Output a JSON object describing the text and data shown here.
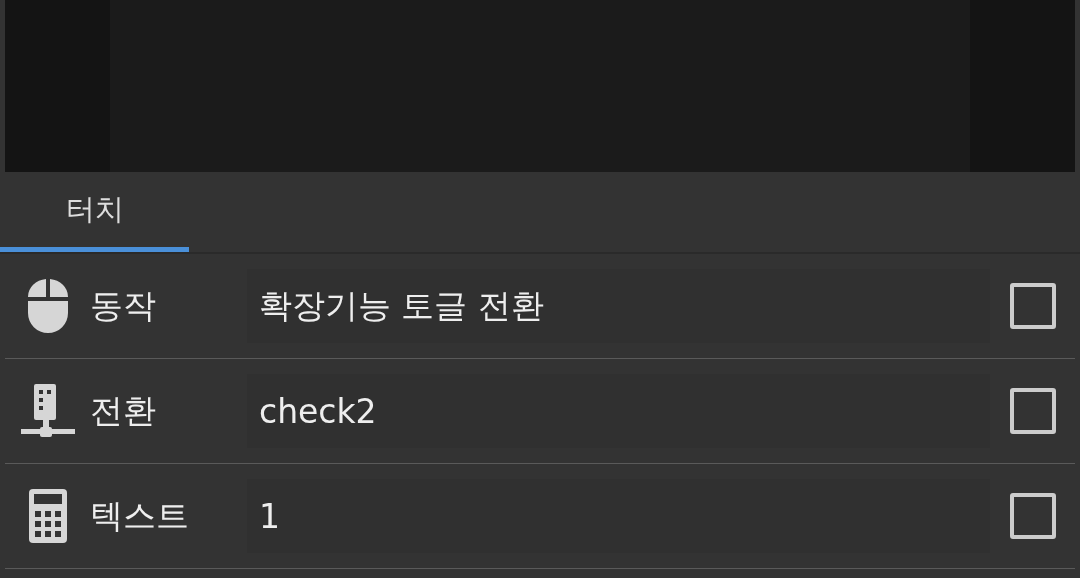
{
  "tabs": [
    {
      "label": "터치",
      "selected": true
    }
  ],
  "rows": [
    {
      "label": "동작",
      "value": "확장기능 토글 전환",
      "checked": false
    },
    {
      "label": "전환",
      "value": "check2",
      "checked": false
    },
    {
      "label": "텍스트",
      "value": "1",
      "checked": false
    }
  ]
}
